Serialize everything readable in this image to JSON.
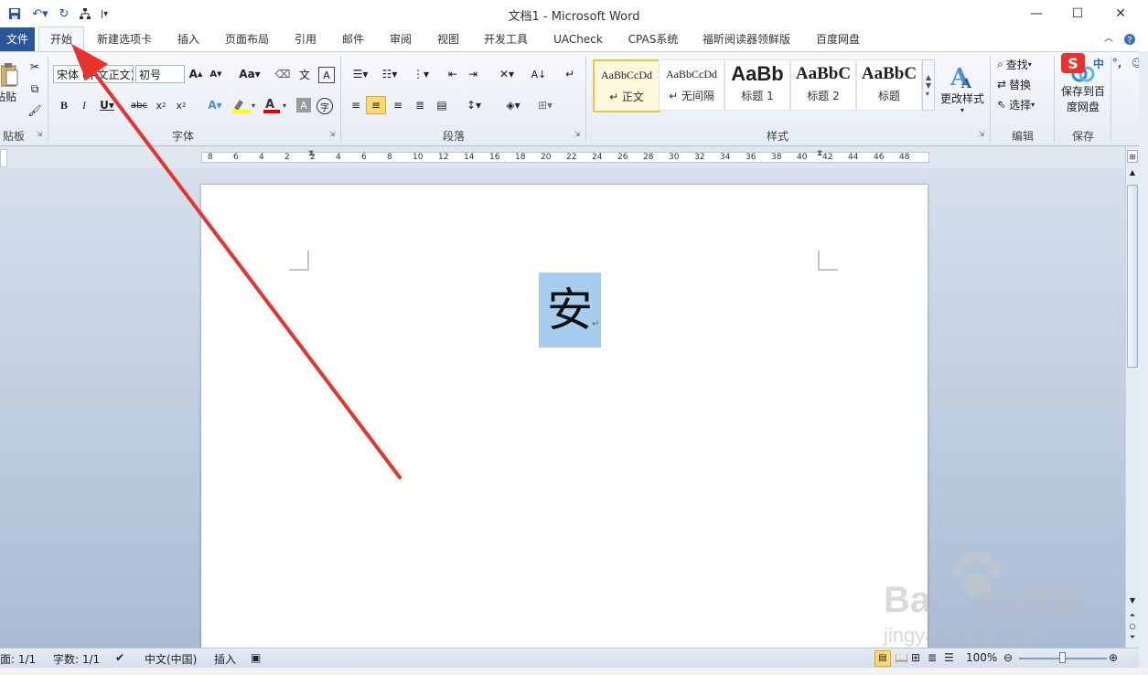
{
  "window": {
    "title": "文档1  -  Microsoft Word",
    "minimize": "—",
    "maximize": "☐",
    "close": "✕"
  },
  "tabs": [
    {
      "label": "文件"
    },
    {
      "label": "开始"
    },
    {
      "label": "新建选项卡"
    },
    {
      "label": "插入"
    },
    {
      "label": "页面布局"
    },
    {
      "label": "引用"
    },
    {
      "label": "邮件"
    },
    {
      "label": "审阅"
    },
    {
      "label": "视图"
    },
    {
      "label": "开发工具"
    },
    {
      "label": "UACheck"
    },
    {
      "label": "CPAS系统"
    },
    {
      "label": "福昕阅读器领鲜版"
    },
    {
      "label": "百度网盘"
    }
  ],
  "ribbon": {
    "clipboard": {
      "label": "贴板",
      "paste": "粘贴"
    },
    "font": {
      "label": "字体",
      "font_name": "宋体 (中文正文)",
      "font_size": "初号",
      "change_case": "Aa"
    },
    "paragraph": {
      "label": "段落"
    },
    "styles": {
      "label": "样式",
      "items": [
        {
          "sample": "AaBbCcDd",
          "name": "↵ 正文"
        },
        {
          "sample": "AaBbCcDd",
          "name": "↵ 无间隔"
        },
        {
          "sample": "AaBb",
          "name": "标题 1"
        },
        {
          "sample": "AaBbC",
          "name": "标题 2"
        },
        {
          "sample": "AaBbC",
          "name": "标题"
        }
      ],
      "change_styles": "更改样式"
    },
    "editing": {
      "label": "编辑",
      "find": "查找",
      "replace": "替换",
      "select": "选择"
    },
    "save": {
      "label": "保存",
      "button": "保存到百度网盘"
    },
    "ime": {
      "lang": "中",
      "punct": "°,"
    }
  },
  "ruler": {
    "numbers": [
      "8",
      "6",
      "4",
      "2",
      "2",
      "4",
      "6",
      "8",
      "10",
      "12",
      "14",
      "16",
      "18",
      "20",
      "22",
      "24",
      "26",
      "28",
      "30",
      "32",
      "34",
      "36",
      "38",
      "40",
      "42",
      "44",
      "46",
      "48"
    ]
  },
  "document": {
    "text": "安",
    "para_mark": "↵"
  },
  "status": {
    "page": "面: 1/1",
    "words": "字数: 1/1",
    "language": "中文(中国)",
    "mode": "插入",
    "zoom": "100%"
  },
  "watermark": {
    "brand": "Bai",
    "brand2": "du",
    "cn": "经验",
    "url": "jingyan.baidu.com"
  },
  "colors": {
    "file_tab": "#2b579a",
    "selection": "#a6cdee",
    "arrow": "#e8322d"
  }
}
